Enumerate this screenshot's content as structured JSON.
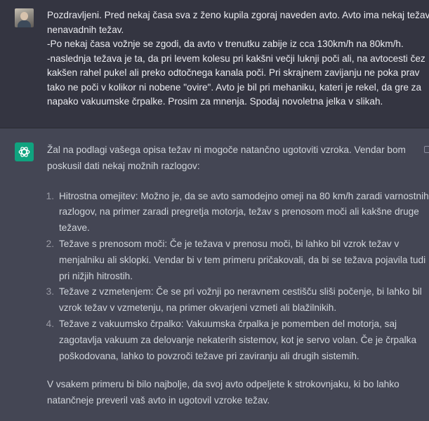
{
  "user_message": {
    "lines": [
      "Pozdravljeni. Pred nekaj časa sva z ženo kupila zgoraj naveden avto. Avto ima nekaj težav",
      "nenavadnih težav.",
      "-Po nekaj časa vožnje se zgodi, da avto v trenutku zabije iz cca 130km/h na 80km/h.",
      "-naslednja težava je ta, da pri levem kolesu pri kakšni večji luknji poči ali, na avtocesti čez",
      "kakšen rahel pukel ali preko odtočnega kanala poči. Pri skrajnem zavijanju ne poka prav",
      "tako ne poči v kolikor ni nobene \"ovire\". Avto je bil pri mehaniku, kateri je rekel, da gre za",
      "napako vakuumske črpalke. Prosim za mnenja. Spodaj novoletna jelka v slikah."
    ]
  },
  "assistant_message": {
    "intro_lines": [
      "Žal na podlagi vašega opisa težav ni mogoče natančno ugotoviti vzroka. Vendar bom",
      "poskusil dati nekaj možnih razlogov:"
    ],
    "items": [
      {
        "number": "1.",
        "lines": [
          "Hitrostna omejitev: Možno je, da se avto samodejno omeji na 80 km/h zaradi varnostnih",
          "razlogov, na primer zaradi pregretja motorja, težav s prenosom moči ali kakšne druge",
          "težave."
        ]
      },
      {
        "number": "2.",
        "lines": [
          "Težave s prenosom moči: Če je težava v prenosu moči, bi lahko bil vzrok težav v",
          "menjalniku ali sklopki. Vendar bi v tem primeru pričakovali, da bi se težava pojavila tudi",
          "pri nižjih hitrostih."
        ]
      },
      {
        "number": "3.",
        "lines": [
          "Težave z vzmetenjem: Če se pri vožnji po neravnem cestišču sliši počenje, bi lahko bil",
          "vzrok težav v vzmetenju, na primer okvarjeni vzmeti ali blažilnikih."
        ]
      },
      {
        "number": "4.",
        "lines": [
          "Težave z vakuumsko črpalko: Vakuumska črpalka je pomemben del motorja, saj",
          "zagotavlja vakuum za delovanje nekaterih sistemov, kot je servo volan. Če je črpalka",
          "poškodovana, lahko to povzroči težave pri zaviranju ali drugih sistemih."
        ]
      }
    ],
    "closing_lines": [
      "V vsakem primeru bi bilo najbolje, da svoj avto odpeljete k strokovnjaku, ki bo lahko",
      "natančneje preveril vaš avto in ugotovil vzroke težav."
    ]
  },
  "icons": {
    "user_avatar": "user-avatar-icon",
    "assistant_avatar": "openai-logo-icon",
    "copy": "copy-icon"
  },
  "colors": {
    "user_bg": "#343541",
    "assistant_bg": "#444654",
    "avatar_green": "#10a37f"
  }
}
